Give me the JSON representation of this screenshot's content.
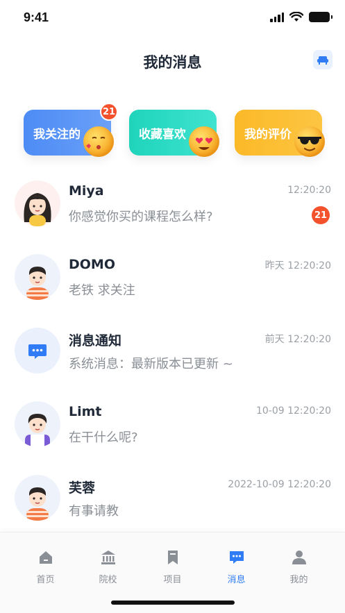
{
  "status_bar": {
    "time": "9:41"
  },
  "header": {
    "title": "我的消息",
    "action_icon": "sofa-icon"
  },
  "colors": {
    "accent": "#2f7cf6",
    "badge": "#f4522d",
    "card_follow": "#4d8cf5",
    "card_collect": "#26d9c2",
    "card_review": "#fbb928"
  },
  "cards": [
    {
      "label": "我关注的",
      "badge": "21",
      "icon": "kissing-face-emoji"
    },
    {
      "label": "收藏喜欢",
      "icon": "heart-eyes-emoji"
    },
    {
      "label": "我的评价",
      "icon": "sunglasses-emoji"
    }
  ],
  "messages": [
    {
      "name": "Miya",
      "time": "12:20:20",
      "preview": "你感觉你买的课程怎么样?",
      "badge": "21",
      "avatar": "girl-avatar"
    },
    {
      "name": "DOMO",
      "time": "昨天 12:20:20",
      "preview": "老铁 求关注",
      "avatar": "boy-avatar"
    },
    {
      "name": "消息通知",
      "time": "前天 12:20:20",
      "preview": "系统消息：最新版本已更新 ~",
      "avatar": "chat-bubble-icon"
    },
    {
      "name": "Limt",
      "time": "10-09 12:20:20",
      "preview": "在干什么呢?",
      "avatar": "boy-avatar"
    },
    {
      "name": "芙蓉",
      "time": "2022-10-09 12:20:20",
      "preview": "有事请教",
      "avatar": "boy-avatar"
    }
  ],
  "tabs": [
    {
      "label": "首页",
      "icon": "home-icon",
      "active": false
    },
    {
      "label": "院校",
      "icon": "school-icon",
      "active": false
    },
    {
      "label": "项目",
      "icon": "bookmark-icon",
      "active": false
    },
    {
      "label": "消息",
      "icon": "message-icon",
      "active": true
    },
    {
      "label": "我的",
      "icon": "person-icon",
      "active": false
    }
  ]
}
